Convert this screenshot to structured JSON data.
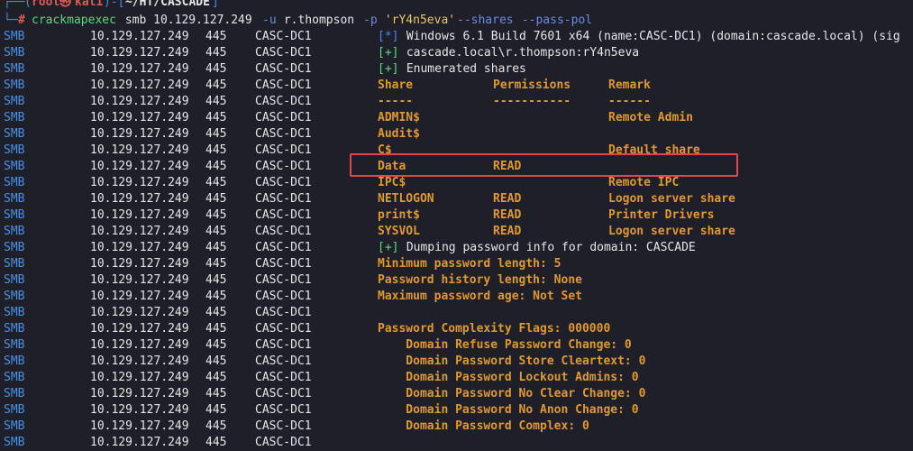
{
  "prompt": {
    "corner_top": "┌──",
    "user": "root",
    "at_symbol": "㉿",
    "host": "kali",
    "dash": ")-[",
    "path": "~/HT/CASCADE",
    "close_bracket": "]",
    "corner_bottom": "└─",
    "hash": "#",
    "open_paren": "("
  },
  "command": {
    "bin": "crackmapexec",
    "args": " smb 10.129.127.249 ",
    "u_flag": "-u",
    "user": " r.thompson ",
    "p_flag": "-p",
    "password": " 'rY4n5eva' ",
    "shares_flag": "--shares",
    "polflag": " --pass-pol"
  },
  "smb_prefix": {
    "proto": "SMB",
    "ip": "10.129.127.249",
    "port": "445",
    "host": "CASC-DC1"
  },
  "output": [
    {
      "kind": "info",
      "marker": "[*]",
      "text": " Windows 6.1 Build 7601 x64 (name:CASC-DC1) (domain:cascade.local) (sig"
    },
    {
      "kind": "ok",
      "marker": "[+]",
      "text": " cascade.local\\r.thompson:rY4n5eva"
    },
    {
      "kind": "ok",
      "marker": "[+]",
      "text": " Enumerated shares"
    },
    {
      "kind": "row",
      "share": "Share",
      "perm": "Permissions",
      "remark": "Remark"
    },
    {
      "kind": "row",
      "share": "-----",
      "perm": "-----------",
      "remark": "------"
    },
    {
      "kind": "row",
      "share": "ADMIN$",
      "perm": "",
      "remark": "Remote Admin"
    },
    {
      "kind": "row",
      "share": "Audit$",
      "perm": "",
      "remark": ""
    },
    {
      "kind": "row",
      "share": "C$",
      "perm": "",
      "remark": "Default share"
    },
    {
      "kind": "row",
      "share": "Data",
      "perm": "READ",
      "remark": ""
    },
    {
      "kind": "row",
      "share": "IPC$",
      "perm": "",
      "remark": "Remote IPC"
    },
    {
      "kind": "row",
      "share": "NETLOGON",
      "perm": "READ",
      "remark": "Logon server share"
    },
    {
      "kind": "row",
      "share": "print$",
      "perm": "READ",
      "remark": "Printer Drivers"
    },
    {
      "kind": "row",
      "share": "SYSVOL",
      "perm": "READ",
      "remark": "Logon server share"
    },
    {
      "kind": "ok",
      "marker": "[+]",
      "text": " Dumping password info for domain: CASCADE"
    },
    {
      "kind": "text",
      "text": "Minimum password length: 5"
    },
    {
      "kind": "text",
      "text": "Password history length: None"
    },
    {
      "kind": "text",
      "text": "Maximum password age: Not Set"
    },
    {
      "kind": "text",
      "text": ""
    },
    {
      "kind": "text",
      "text": "Password Complexity Flags: 000000"
    },
    {
      "kind": "text",
      "text": "    Domain Refuse Password Change: 0"
    },
    {
      "kind": "text",
      "text": "    Domain Password Store Cleartext: 0"
    },
    {
      "kind": "text",
      "text": "    Domain Password Lockout Admins: 0"
    },
    {
      "kind": "text",
      "text": "    Domain Password No Clear Change: 0"
    },
    {
      "kind": "text",
      "text": "    Domain Password No Anon Change: 0"
    },
    {
      "kind": "text",
      "text": "    Domain Password Complex: 0"
    },
    {
      "kind": "text",
      "text": ""
    }
  ],
  "colors": {
    "background": "#1e1f29",
    "prompt_blue": "#4a88e8",
    "prompt_red": "#e05a55",
    "command_green": "#5fd97f",
    "string_yellow": "#e9c46a",
    "output_orange": "#e0992f",
    "highlight_red": "#e0474c"
  }
}
